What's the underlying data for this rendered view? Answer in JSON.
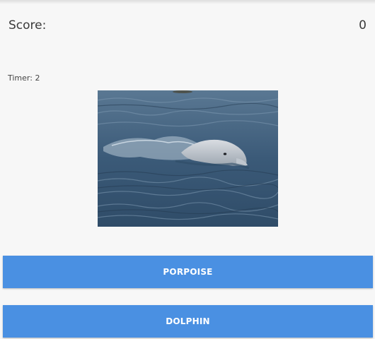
{
  "score": {
    "label": "Score:",
    "value": "0"
  },
  "timer": {
    "label": "Timer: 2"
  },
  "photo": {
    "subject": "dolphin-swimming-image"
  },
  "answers": [
    {
      "label": "PORPOISE"
    },
    {
      "label": "DOLPHIN"
    }
  ],
  "colors": {
    "background": "#f7f7f7",
    "button": "#4a90e2",
    "button_text": "#ffffff",
    "text": "#3a3a3a"
  }
}
